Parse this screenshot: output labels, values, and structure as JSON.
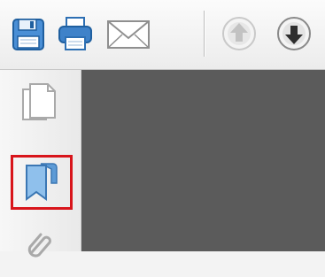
{
  "toolbar": {
    "buttons": [
      {
        "icon": "save-icon"
      },
      {
        "icon": "print-icon"
      },
      {
        "icon": "email-icon"
      },
      {
        "icon": "previous-page-icon"
      },
      {
        "icon": "next-page-icon"
      }
    ]
  },
  "nav_pane": {
    "buttons": [
      {
        "icon": "page-thumbnails-icon"
      },
      {
        "icon": "bookmarks-icon",
        "highlighted": true
      },
      {
        "icon": "attachments-icon"
      }
    ]
  },
  "colors": {
    "highlight": "#d8151b",
    "document_area": "#5b5b5b",
    "icon_blue": "#3f82c9"
  }
}
